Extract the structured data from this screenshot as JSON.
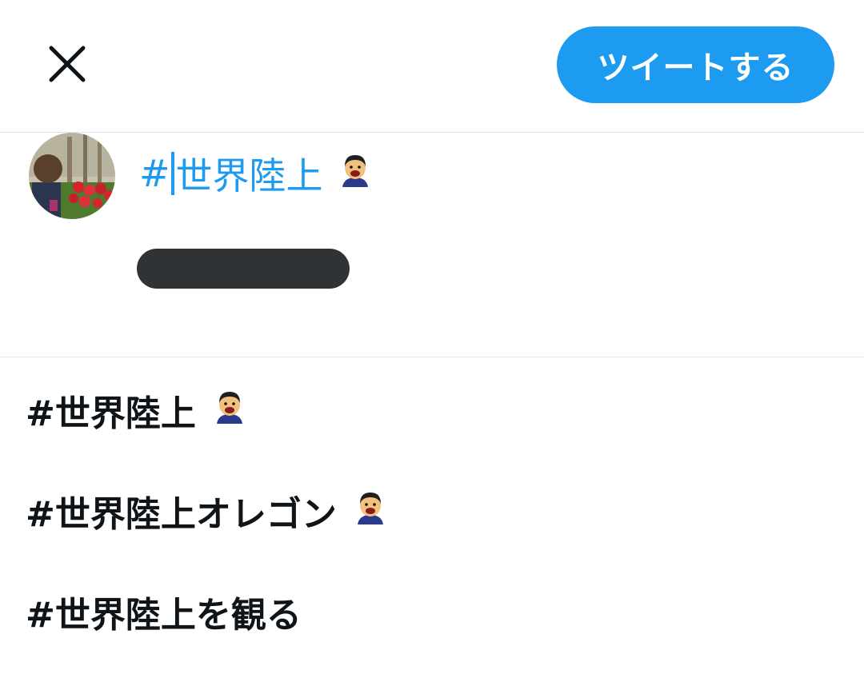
{
  "header": {
    "close_icon": "close-icon",
    "tweet_button_label": "ツイートする",
    "accent_color": "#1d9bf0"
  },
  "composer": {
    "avatar": "user-avatar-photo",
    "text_before_caret": "#",
    "text_after_caret": "世界陸上",
    "emoji_icon": "athletics-mascot-emoji",
    "redacted_field": "redacted"
  },
  "suggestions": [
    {
      "label": "#世界陸上",
      "emoji": "athletics-mascot-emoji"
    },
    {
      "label": "#世界陸上オレゴン",
      "emoji": "athletics-mascot-emoji"
    },
    {
      "label": "#世界陸上を観る",
      "emoji": ""
    }
  ]
}
